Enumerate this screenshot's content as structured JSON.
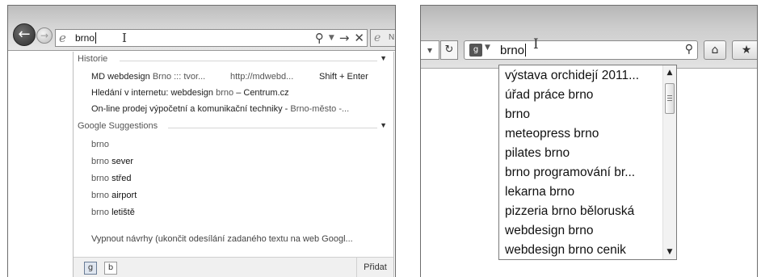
{
  "ie": {
    "address_text": "brno",
    "history_label": "Historie",
    "history": [
      {
        "title_plain": "MD webdesign ",
        "title_dim": "Brno ::: tvor...",
        "url": "http://mdwebd...",
        "shortcut": "Shift + Enter"
      },
      {
        "title_plain": "Hledání v internetu: webdesign ",
        "title_dim": "brno",
        "title_rest": " – Centrum.cz"
      },
      {
        "title_plain": "On-line prodej výpočetní a komunikační techniky - ",
        "title_dim": "Brno-město -..."
      }
    ],
    "suggestions_label": "Google Suggestions",
    "suggestions": [
      {
        "prefix": "brno",
        "suffix": ""
      },
      {
        "prefix": "brno ",
        "suffix": "sever"
      },
      {
        "prefix": "brno ",
        "suffix": "střed"
      },
      {
        "prefix": "brno ",
        "suffix": "airport"
      },
      {
        "prefix": "brno ",
        "suffix": "letiště"
      }
    ],
    "disable_text": "Vypnout návrhy (ukončit odesílání zadaného textu na web Googl...",
    "add_label": "Přidat",
    "tab_partial": "N"
  },
  "ff": {
    "search_text": "brno",
    "suggestions": [
      "výstava orchidejí 2011...",
      "úřad práce brno",
      "brno",
      "meteopress brno",
      "pilates brno",
      "brno programování br...",
      "lekarna brno",
      "pizzeria brno běloruská",
      "webdesign brno",
      "webdesign brno cenik"
    ]
  }
}
